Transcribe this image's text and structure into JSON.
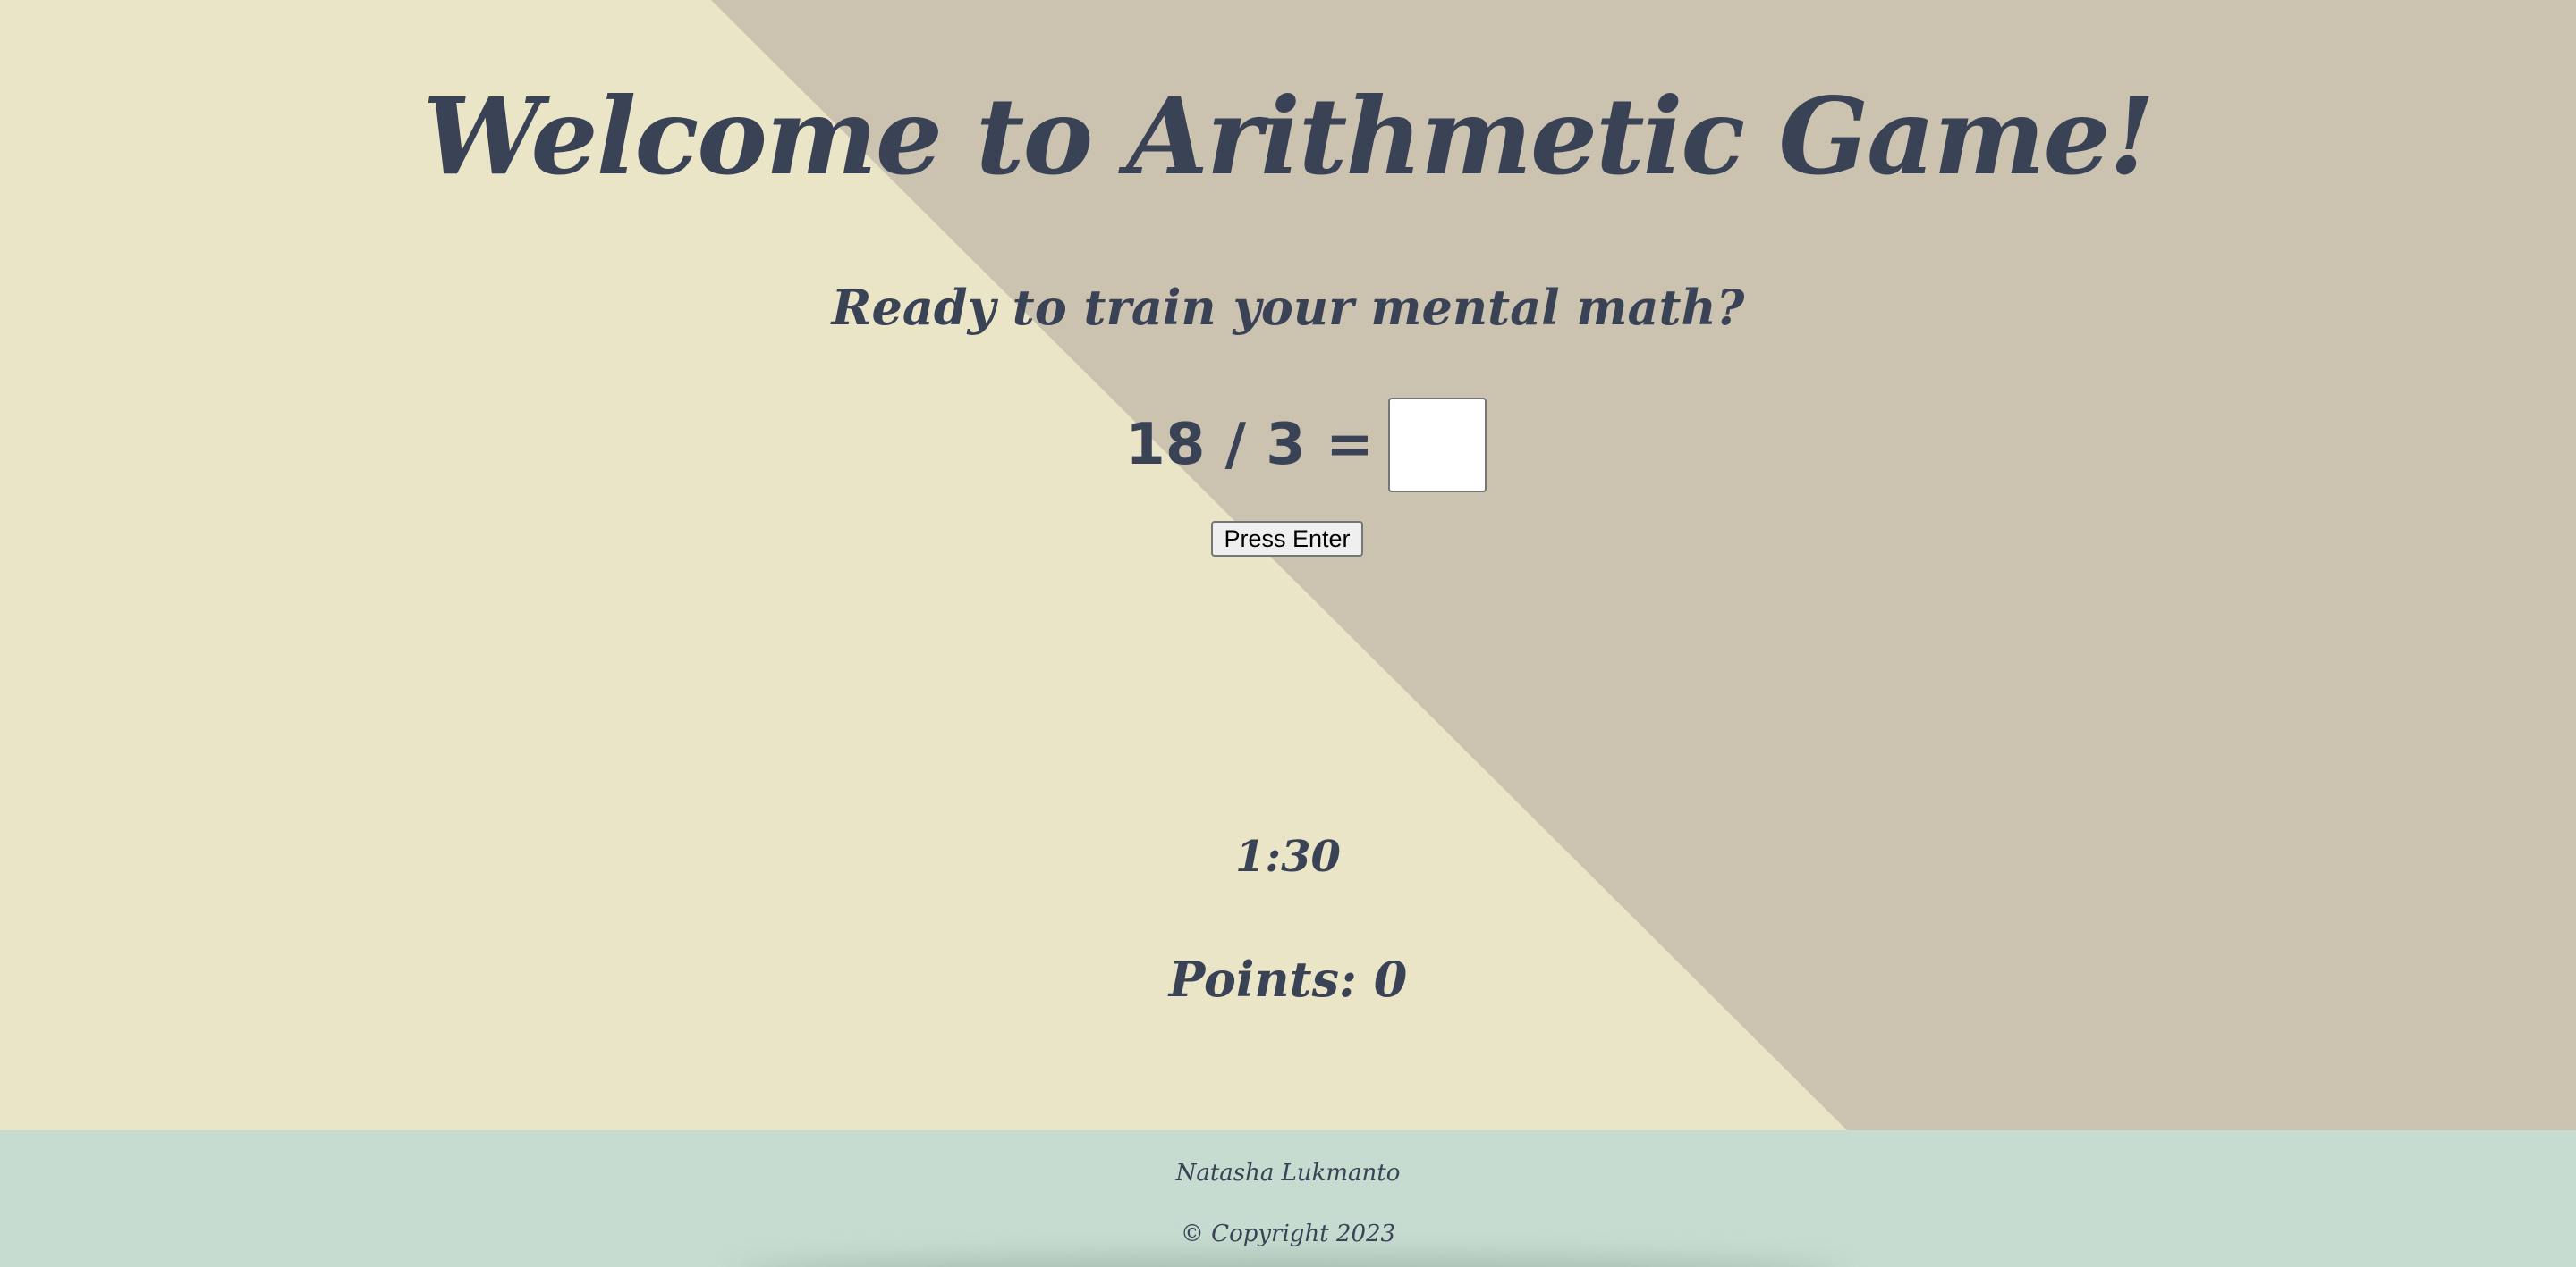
{
  "header": {
    "title": "Welcome to Arithmetic Game!",
    "subtitle": "Ready to train your mental math?"
  },
  "game": {
    "question": "18 / 3 =",
    "answer_value": "",
    "enter_button_label": "Press Enter",
    "timer": "1:30",
    "points": "Points: 0"
  },
  "footer": {
    "author": "Natasha Lukmanto",
    "copyright": "© Copyright 2023"
  },
  "colors": {
    "background_light": "#ebe5c8",
    "background_dark": "#cbc2af",
    "footer_bg": "#c6dcd0",
    "text": "#3a4256"
  }
}
